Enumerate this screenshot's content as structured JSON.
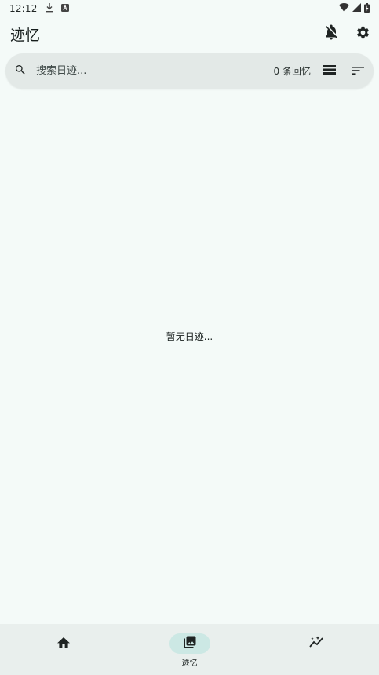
{
  "status_bar": {
    "time": "12:12",
    "icons": [
      "download-icon",
      "a-badge-icon",
      "wifi-icon",
      "signal-icon",
      "battery-icon"
    ]
  },
  "app_bar": {
    "title": "迹忆",
    "actions": [
      "notifications-off-icon",
      "settings-icon"
    ]
  },
  "search": {
    "placeholder": "搜索日迹...",
    "value": "",
    "count_text": "0 条回忆",
    "icons": [
      "search-icon",
      "list-view-icon",
      "sort-icon"
    ]
  },
  "main": {
    "empty_text": "暂无日迹..."
  },
  "bottom_nav": {
    "items": [
      {
        "icon": "home-icon",
        "label": "",
        "active": false
      },
      {
        "icon": "photo-library-icon",
        "label": "迹忆",
        "active": true
      },
      {
        "icon": "insights-icon",
        "label": "",
        "active": false
      }
    ]
  },
  "colors": {
    "background": "#f4faf8",
    "search_bar": "#e3e9e7",
    "nav_bar": "#e9efed",
    "active_pill": "#cce8e4",
    "text": "#161d1c"
  }
}
